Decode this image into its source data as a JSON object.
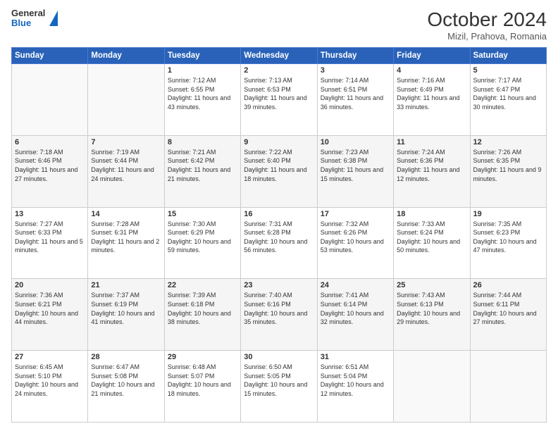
{
  "logo": {
    "general": "General",
    "blue": "Blue"
  },
  "header": {
    "month": "October 2024",
    "location": "Mizil, Prahova, Romania"
  },
  "weekdays": [
    "Sunday",
    "Monday",
    "Tuesday",
    "Wednesday",
    "Thursday",
    "Friday",
    "Saturday"
  ],
  "weeks": [
    [
      {
        "day": "",
        "sunrise": "",
        "sunset": "",
        "daylight": ""
      },
      {
        "day": "",
        "sunrise": "",
        "sunset": "",
        "daylight": ""
      },
      {
        "day": "1",
        "sunrise": "Sunrise: 7:12 AM",
        "sunset": "Sunset: 6:55 PM",
        "daylight": "Daylight: 11 hours and 43 minutes."
      },
      {
        "day": "2",
        "sunrise": "Sunrise: 7:13 AM",
        "sunset": "Sunset: 6:53 PM",
        "daylight": "Daylight: 11 hours and 39 minutes."
      },
      {
        "day": "3",
        "sunrise": "Sunrise: 7:14 AM",
        "sunset": "Sunset: 6:51 PM",
        "daylight": "Daylight: 11 hours and 36 minutes."
      },
      {
        "day": "4",
        "sunrise": "Sunrise: 7:16 AM",
        "sunset": "Sunset: 6:49 PM",
        "daylight": "Daylight: 11 hours and 33 minutes."
      },
      {
        "day": "5",
        "sunrise": "Sunrise: 7:17 AM",
        "sunset": "Sunset: 6:47 PM",
        "daylight": "Daylight: 11 hours and 30 minutes."
      }
    ],
    [
      {
        "day": "6",
        "sunrise": "Sunrise: 7:18 AM",
        "sunset": "Sunset: 6:46 PM",
        "daylight": "Daylight: 11 hours and 27 minutes."
      },
      {
        "day": "7",
        "sunrise": "Sunrise: 7:19 AM",
        "sunset": "Sunset: 6:44 PM",
        "daylight": "Daylight: 11 hours and 24 minutes."
      },
      {
        "day": "8",
        "sunrise": "Sunrise: 7:21 AM",
        "sunset": "Sunset: 6:42 PM",
        "daylight": "Daylight: 11 hours and 21 minutes."
      },
      {
        "day": "9",
        "sunrise": "Sunrise: 7:22 AM",
        "sunset": "Sunset: 6:40 PM",
        "daylight": "Daylight: 11 hours and 18 minutes."
      },
      {
        "day": "10",
        "sunrise": "Sunrise: 7:23 AM",
        "sunset": "Sunset: 6:38 PM",
        "daylight": "Daylight: 11 hours and 15 minutes."
      },
      {
        "day": "11",
        "sunrise": "Sunrise: 7:24 AM",
        "sunset": "Sunset: 6:36 PM",
        "daylight": "Daylight: 11 hours and 12 minutes."
      },
      {
        "day": "12",
        "sunrise": "Sunrise: 7:26 AM",
        "sunset": "Sunset: 6:35 PM",
        "daylight": "Daylight: 11 hours and 9 minutes."
      }
    ],
    [
      {
        "day": "13",
        "sunrise": "Sunrise: 7:27 AM",
        "sunset": "Sunset: 6:33 PM",
        "daylight": "Daylight: 11 hours and 5 minutes."
      },
      {
        "day": "14",
        "sunrise": "Sunrise: 7:28 AM",
        "sunset": "Sunset: 6:31 PM",
        "daylight": "Daylight: 11 hours and 2 minutes."
      },
      {
        "day": "15",
        "sunrise": "Sunrise: 7:30 AM",
        "sunset": "Sunset: 6:29 PM",
        "daylight": "Daylight: 10 hours and 59 minutes."
      },
      {
        "day": "16",
        "sunrise": "Sunrise: 7:31 AM",
        "sunset": "Sunset: 6:28 PM",
        "daylight": "Daylight: 10 hours and 56 minutes."
      },
      {
        "day": "17",
        "sunrise": "Sunrise: 7:32 AM",
        "sunset": "Sunset: 6:26 PM",
        "daylight": "Daylight: 10 hours and 53 minutes."
      },
      {
        "day": "18",
        "sunrise": "Sunrise: 7:33 AM",
        "sunset": "Sunset: 6:24 PM",
        "daylight": "Daylight: 10 hours and 50 minutes."
      },
      {
        "day": "19",
        "sunrise": "Sunrise: 7:35 AM",
        "sunset": "Sunset: 6:23 PM",
        "daylight": "Daylight: 10 hours and 47 minutes."
      }
    ],
    [
      {
        "day": "20",
        "sunrise": "Sunrise: 7:36 AM",
        "sunset": "Sunset: 6:21 PM",
        "daylight": "Daylight: 10 hours and 44 minutes."
      },
      {
        "day": "21",
        "sunrise": "Sunrise: 7:37 AM",
        "sunset": "Sunset: 6:19 PM",
        "daylight": "Daylight: 10 hours and 41 minutes."
      },
      {
        "day": "22",
        "sunrise": "Sunrise: 7:39 AM",
        "sunset": "Sunset: 6:18 PM",
        "daylight": "Daylight: 10 hours and 38 minutes."
      },
      {
        "day": "23",
        "sunrise": "Sunrise: 7:40 AM",
        "sunset": "Sunset: 6:16 PM",
        "daylight": "Daylight: 10 hours and 35 minutes."
      },
      {
        "day": "24",
        "sunrise": "Sunrise: 7:41 AM",
        "sunset": "Sunset: 6:14 PM",
        "daylight": "Daylight: 10 hours and 32 minutes."
      },
      {
        "day": "25",
        "sunrise": "Sunrise: 7:43 AM",
        "sunset": "Sunset: 6:13 PM",
        "daylight": "Daylight: 10 hours and 29 minutes."
      },
      {
        "day": "26",
        "sunrise": "Sunrise: 7:44 AM",
        "sunset": "Sunset: 6:11 PM",
        "daylight": "Daylight: 10 hours and 27 minutes."
      }
    ],
    [
      {
        "day": "27",
        "sunrise": "Sunrise: 6:45 AM",
        "sunset": "Sunset: 5:10 PM",
        "daylight": "Daylight: 10 hours and 24 minutes."
      },
      {
        "day": "28",
        "sunrise": "Sunrise: 6:47 AM",
        "sunset": "Sunset: 5:08 PM",
        "daylight": "Daylight: 10 hours and 21 minutes."
      },
      {
        "day": "29",
        "sunrise": "Sunrise: 6:48 AM",
        "sunset": "Sunset: 5:07 PM",
        "daylight": "Daylight: 10 hours and 18 minutes."
      },
      {
        "day": "30",
        "sunrise": "Sunrise: 6:50 AM",
        "sunset": "Sunset: 5:05 PM",
        "daylight": "Daylight: 10 hours and 15 minutes."
      },
      {
        "day": "31",
        "sunrise": "Sunrise: 6:51 AM",
        "sunset": "Sunset: 5:04 PM",
        "daylight": "Daylight: 10 hours and 12 minutes."
      },
      {
        "day": "",
        "sunrise": "",
        "sunset": "",
        "daylight": ""
      },
      {
        "day": "",
        "sunrise": "",
        "sunset": "",
        "daylight": ""
      }
    ]
  ]
}
